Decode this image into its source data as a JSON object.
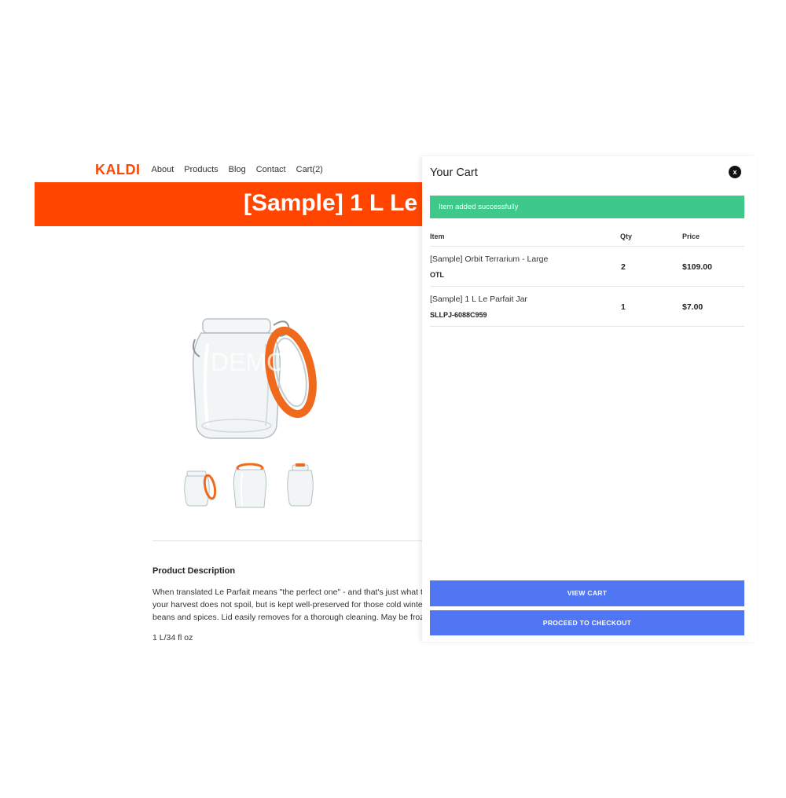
{
  "header": {
    "logo": "KALDI",
    "nav": [
      "About",
      "Products",
      "Blog",
      "Contact",
      "Cart(2)"
    ]
  },
  "product": {
    "title": "[Sample] 1 L Le",
    "watermark": "DEMO",
    "description_title": "Product Description",
    "description_lines": [
      "When translated Le Parfait means \"the perfect one\" - and that's just what thi",
      "your harvest does not spoil, but is kept well-preserved for those cold winter r",
      "beans and spices. Lid easily removes for a thorough cleaning. May be frozen"
    ],
    "size": "1 L/34 fl oz"
  },
  "cart": {
    "title": "Your Cart",
    "close_label": "x",
    "alert": "Item added successfully",
    "columns": {
      "item": "Item",
      "qty": "Qty",
      "price": "Price"
    },
    "items": [
      {
        "name": "[Sample] Orbit Terrarium - Large",
        "sku": "OTL",
        "qty": "2",
        "price": "$109.00"
      },
      {
        "name": "[Sample] 1 L Le Parfait Jar",
        "sku": "SLLPJ-6088C959",
        "qty": "1",
        "price": "$7.00"
      }
    ],
    "view_cart": "VIEW CART",
    "checkout": "PROCEED TO CHECKOUT"
  },
  "colors": {
    "brand": "#ff4500",
    "alert": "#3ec98b",
    "button": "#5076f3",
    "jar_seal": "#f06a1e"
  }
}
